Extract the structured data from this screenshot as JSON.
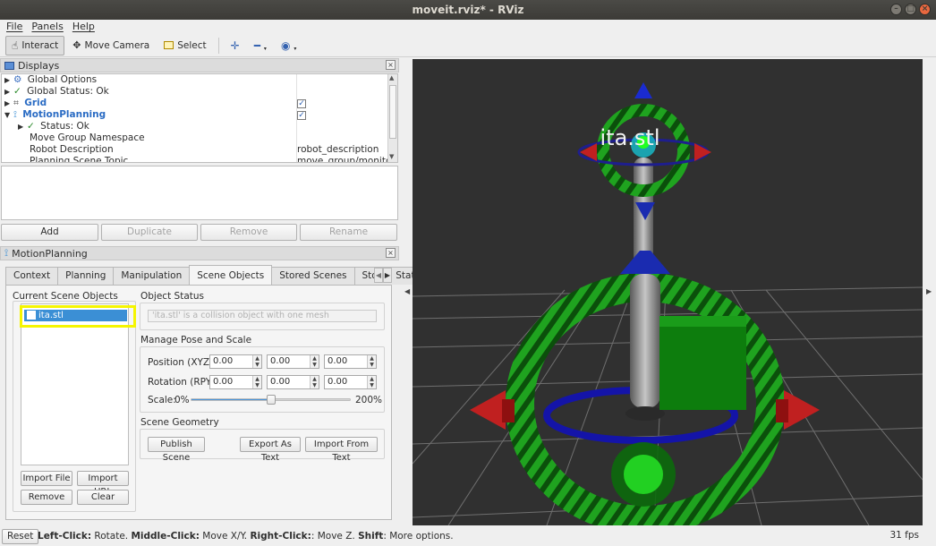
{
  "window": {
    "title": "moveit.rviz* - RViz"
  },
  "menu": [
    "File",
    "Panels",
    "Help"
  ],
  "toolbar": {
    "interact": "Interact",
    "move_camera": "Move Camera",
    "select": "Select",
    "icons": [
      "plus-crosshair-icon",
      "minus-icon",
      "eye-icon"
    ]
  },
  "displays": {
    "title": "Displays",
    "rows": [
      {
        "label": "Global Options",
        "value": ""
      },
      {
        "label": "Global Status: Ok",
        "value": ""
      },
      {
        "label": "Grid",
        "value": ""
      },
      {
        "label": "MotionPlanning",
        "value": ""
      },
      {
        "label": "Status: Ok",
        "value": ""
      },
      {
        "label": "Move Group Namespace",
        "value": ""
      },
      {
        "label": "Robot Description",
        "value": "robot_description"
      },
      {
        "label": "Planning Scene Topic",
        "value": "move_group/monitore"
      }
    ],
    "buttons": {
      "add": "Add",
      "duplicate": "Duplicate",
      "remove": "Remove",
      "rename": "Rename"
    }
  },
  "motion_planning": {
    "title": "MotionPlanning",
    "tabs": [
      "Context",
      "Planning",
      "Manipulation",
      "Scene Objects",
      "Stored Scenes",
      "Stored States"
    ],
    "active_tab": "Scene Objects",
    "current_scene_objects": {
      "label": "Current Scene Objects",
      "items": [
        "ita.stl"
      ]
    },
    "object_status": {
      "label": "Object Status",
      "text": "'ita.stl' is a collision object with one mesh"
    },
    "manage_pose": {
      "label": "Manage Pose and Scale",
      "position_label": "Position (XYZ):",
      "position": [
        "0.00",
        "0.00",
        "0.00"
      ],
      "rotation_label": "Rotation (RPY):",
      "rotation": [
        "0.00",
        "0.00",
        "0.00"
      ],
      "scale_label": "Scale:",
      "scale_min": "0%",
      "scale_max": "200%",
      "scale_value": 0.5
    },
    "scene_geometry": {
      "label": "Scene Geometry",
      "publish": "Publish Scene",
      "export": "Export As Text",
      "import": "Import From Text"
    },
    "list_buttons": {
      "import_file": "Import File",
      "import_url": "Import URL",
      "remove": "Remove",
      "clear": "Clear"
    }
  },
  "viewport": {
    "object_label": "ita.stl"
  },
  "statusbar": {
    "reset": "Reset",
    "hint_parts": [
      {
        "bold": "Left-Click:",
        "text": " Rotate. "
      },
      {
        "bold": "Middle-Click:",
        "text": " Move X/Y. "
      },
      {
        "bold": "Right-Click:",
        "text": ": Move Z. "
      },
      {
        "bold": "Shift",
        "text": ": More options."
      }
    ],
    "fps": "31 fps"
  }
}
